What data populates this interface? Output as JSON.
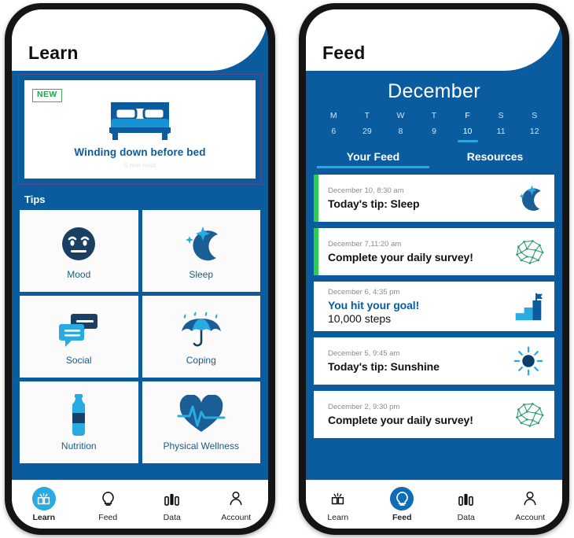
{
  "colors": {
    "brand_blue": "#0b5c9e",
    "accent_cyan": "#29abe2",
    "green": "#2ecc4f",
    "white": "#ffffff",
    "nav_selected_feed": "#0f6cb5"
  },
  "learn_phone": {
    "header_title": "Learn",
    "hero": {
      "badge": "NEW",
      "icon": "bed-icon",
      "title": "Winding down before bed",
      "subtitle": "5 min read"
    },
    "tips_section_label": "Tips",
    "tips": [
      {
        "label": "Mood",
        "icon": "sad-face-icon"
      },
      {
        "label": "Sleep",
        "icon": "moon-stars-icon"
      },
      {
        "label": "Social",
        "icon": "chat-bubbles-icon"
      },
      {
        "label": "Coping",
        "icon": "umbrella-rain-icon"
      },
      {
        "label": "Nutrition",
        "icon": "water-bottle-icon"
      },
      {
        "label": "Physical Wellness",
        "icon": "heart-pulse-icon"
      }
    ],
    "bottom_nav": [
      {
        "label": "Learn",
        "icon": "book-icon",
        "active": true
      },
      {
        "label": "Feed",
        "icon": "lightbulb-icon",
        "active": false
      },
      {
        "label": "Data",
        "icon": "bar-chart-icon",
        "active": false
      },
      {
        "label": "Account",
        "icon": "person-icon",
        "active": false
      }
    ]
  },
  "feed_phone": {
    "header_title": "Feed",
    "month": "December",
    "week": [
      {
        "dow": "M",
        "num": "6",
        "active": false
      },
      {
        "dow": "T",
        "num": "29",
        "active": false
      },
      {
        "dow": "W",
        "num": "8",
        "active": false
      },
      {
        "dow": "T",
        "num": "9",
        "active": false
      },
      {
        "dow": "F",
        "num": "10",
        "active": true
      },
      {
        "dow": "S",
        "num": "11",
        "active": false
      },
      {
        "dow": "S",
        "num": "12",
        "active": false
      }
    ],
    "tabs": [
      {
        "label": "Your Feed",
        "active": true
      },
      {
        "label": "Resources",
        "active": false
      }
    ],
    "cards": [
      {
        "time": "December 10, 8:30 am",
        "title": "Today's tip: Sleep",
        "subtitle": "",
        "icon": "moon-stars-icon",
        "accent": "green",
        "title_color": "black"
      },
      {
        "time": "December 7,11:20 am",
        "title": "Complete your daily survey!",
        "subtitle": "",
        "icon": "brain-icon",
        "accent": "green",
        "title_color": "black"
      },
      {
        "time": "December 6, 4:35 pm",
        "title": "You hit your goal!",
        "subtitle": "10,000 steps",
        "icon": "stairs-flag-icon",
        "accent": "none",
        "title_color": "blue"
      },
      {
        "time": "December 5, 9:45 am",
        "title": "Today's tip: Sunshine",
        "subtitle": "",
        "icon": "sun-icon",
        "accent": "none",
        "title_color": "black"
      },
      {
        "time": "December 2, 9:30 pm",
        "title": "Complete your daily survey!",
        "subtitle": "",
        "icon": "brain-icon",
        "accent": "none",
        "title_color": "black"
      }
    ],
    "bottom_nav": [
      {
        "label": "Learn",
        "icon": "book-icon",
        "active": false
      },
      {
        "label": "Feed",
        "icon": "lightbulb-icon",
        "active": true
      },
      {
        "label": "Data",
        "icon": "bar-chart-icon",
        "active": false
      },
      {
        "label": "Account",
        "icon": "person-icon",
        "active": false
      }
    ]
  }
}
